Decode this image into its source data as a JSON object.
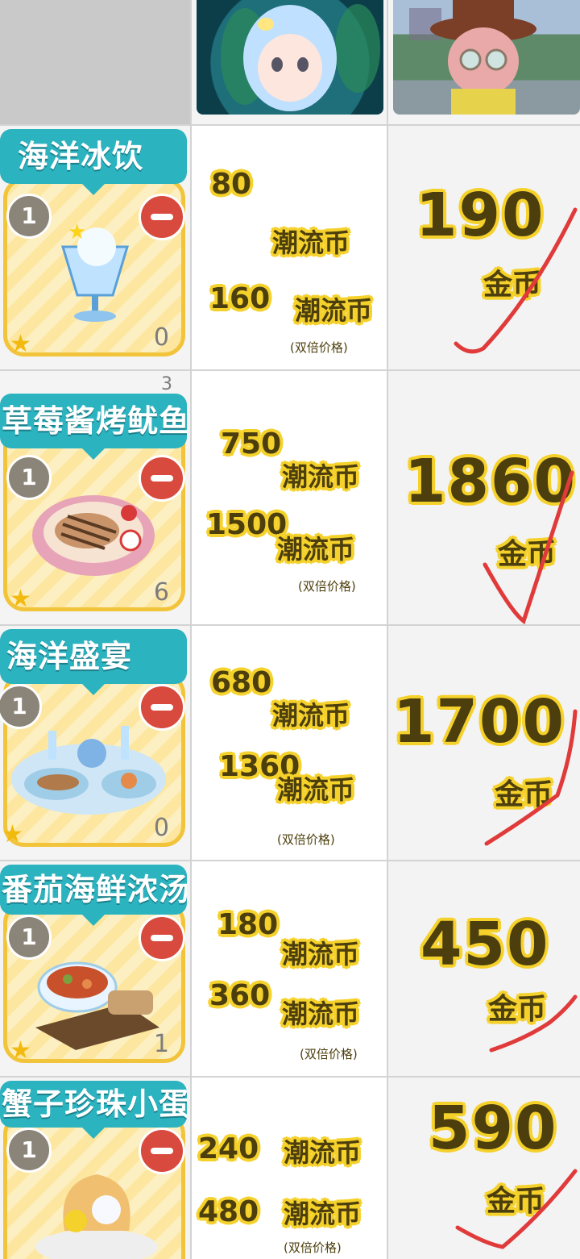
{
  "header": {
    "avatar_left": "avatar",
    "avatar_right": "avatar"
  },
  "unit_trend": "潮流币",
  "unit_gold": "金币",
  "double_note": "(双倍价格)",
  "rows": [
    {
      "name": "海洋冰饮",
      "qty": "1",
      "count": "0",
      "price": "80",
      "price_double": "160",
      "gold": "190"
    },
    {
      "name": "草莓酱烤鱿鱼",
      "qty": "1",
      "count": "6",
      "count_top": "3",
      "price": "750",
      "price_double": "1500",
      "gold": "1860"
    },
    {
      "name": "海洋盛宴",
      "qty": "1",
      "count": "0",
      "price": "680",
      "price_double": "1360",
      "gold": "1700"
    },
    {
      "name": "番茄海鲜浓汤",
      "qty": "1",
      "count": "1",
      "price": "180",
      "price_double": "360",
      "gold": "450"
    },
    {
      "name": "蟹子珍珠小蛋",
      "qty": "1",
      "count": "",
      "price": "240",
      "price_double": "480",
      "gold": "590"
    }
  ],
  "colors": {
    "banner": "#2bb3c0",
    "card_border": "#f2c43c",
    "minus": "#d84a3e",
    "outline": "#f5d12b",
    "text": "#4d3f0d",
    "check": "#e03a3a"
  }
}
